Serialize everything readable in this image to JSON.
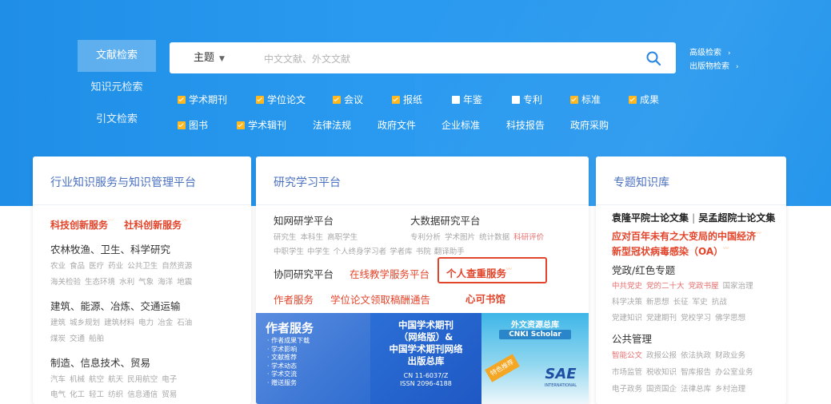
{
  "nav": {
    "items": [
      "文献检索",
      "知识元检索",
      "引文检索"
    ]
  },
  "search": {
    "type_label": "主题",
    "placeholder": "中文文献、外文文献"
  },
  "advanced": {
    "links": [
      "高级检索",
      "出版物检索"
    ]
  },
  "filters": {
    "row1": [
      {
        "label": "学术期刊",
        "checked": true
      },
      {
        "label": "学位论文",
        "checked": true
      },
      {
        "label": "会议",
        "checked": true
      },
      {
        "label": "报纸",
        "checked": true
      },
      {
        "label": "年鉴",
        "checked": false
      },
      {
        "label": "专利",
        "checked": false
      },
      {
        "label": "标准",
        "checked": true
      },
      {
        "label": "成果",
        "checked": true
      }
    ],
    "row2": [
      {
        "label": "图书",
        "checked": true
      },
      {
        "label": "学术辑刊",
        "checked": true
      },
      {
        "label": "法律法规"
      },
      {
        "label": "政府文件"
      },
      {
        "label": "企业标准"
      },
      {
        "label": "科技报告"
      },
      {
        "label": "政府采购"
      }
    ]
  },
  "card1": {
    "title": "行业知识服务与知识管理平台",
    "highlights": [
      "科技创新服务",
      "社科创新服务"
    ],
    "sections": [
      {
        "heading": "农林牧渔、卫生、科学研究",
        "lines": [
          [
            "农业",
            "食品",
            "医疗",
            "药业",
            "公共卫生",
            "自然资源"
          ],
          [
            "海关检验",
            "生态环境",
            "水利",
            "气象",
            "海洋",
            "地震"
          ]
        ]
      },
      {
        "heading": "建筑、能源、冶炼、交通运输",
        "lines": [
          [
            "建筑",
            "城乡规划",
            "建筑材料",
            "电力",
            "冶金",
            "石油"
          ],
          [
            "煤炭",
            "交通",
            "船舶"
          ]
        ]
      },
      {
        "heading": "制造、信息技术、贸易",
        "lines": [
          [
            "汽车",
            "机械",
            "航空",
            "航天",
            "民用航空",
            "电子"
          ],
          [
            "电气",
            "化工",
            "轻工",
            "纺织",
            "信息通信",
            "贸易"
          ]
        ]
      }
    ]
  },
  "card2": {
    "title": "研究学习平台",
    "platform1": {
      "name": "知网研学平台",
      "tags": [
        [
          "研究生",
          "本科生",
          "高职学生"
        ],
        [
          "中职学生",
          "中学生",
          "个人终身学习者",
          "学者库",
          "书院",
          "翻译助手"
        ]
      ]
    },
    "platform2": {
      "name": "大数据研究平台",
      "tags": [
        "专利分析",
        "学术图片",
        "统计数据",
        "科研评价"
      ]
    },
    "row3": [
      "协同研究平台",
      "在线教学服务平台",
      "个人查重服务"
    ],
    "row4": [
      "作者服务",
      "学位论文领取稿酬通告",
      "心可书馆"
    ],
    "banner_author": {
      "title": "作者服务",
      "items": [
        "作者成果下载",
        "学术影响",
        "文献推荐",
        "学术动态",
        "学术交流",
        "赠送服务"
      ]
    },
    "banner_journal": {
      "title": [
        "中国学术期刊",
        "（网络版）&",
        "中国学术期刊网络",
        "出版总库"
      ],
      "cn": "CN 11-6037/Z",
      "issn": "ISSN 2096-4188"
    },
    "banner_foreign": {
      "title": "外文资源总库",
      "subtitle": "CNKI Scholar",
      "badge": "特色推荐",
      "logo": "SAE",
      "logo_sub": "INTERNATIONAL"
    }
  },
  "card3": {
    "title": "专题知识库",
    "academician": [
      "袁隆平院士论文集",
      "吴孟超院士论文集"
    ],
    "red_lines": [
      "应对百年未有之大变局的中国经济",
      "新型冠状病毒感染（OA）"
    ],
    "sections": [
      {
        "heading": "党政/红色专题",
        "lines": [
          [
            "中共党史",
            "党的二十大",
            "党政书屋",
            "国家治理"
          ],
          [
            "科学决策",
            "新思想",
            "长征",
            "军史",
            "抗战"
          ],
          [
            "党建知识",
            "党建期刊",
            "党校学习",
            "佛学思想"
          ]
        ],
        "red_line": true
      },
      {
        "heading": "公共管理",
        "lines": [
          [
            "智能公文",
            "政报公报",
            "依法执政",
            "财政业务"
          ],
          [
            "市场监管",
            "税收知识",
            "智库报告",
            "办公室业务"
          ],
          [
            "电子政务",
            "国资国企",
            "法律总库",
            "乡村治理"
          ]
        ],
        "red_line": true
      }
    ]
  },
  "colors": {
    "hero": "#2a9af0",
    "checkbox": "#ffb81f",
    "card_title": "#4a70c0",
    "red": "#e2452b"
  }
}
